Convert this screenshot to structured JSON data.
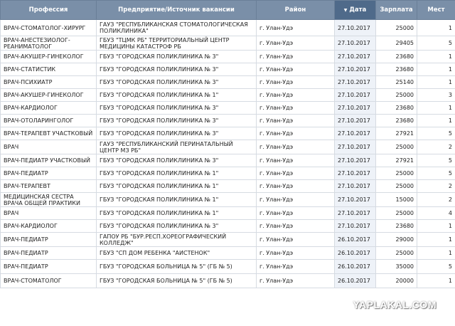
{
  "table": {
    "headers": {
      "profession": "Профессия",
      "employer": "Предприятие/Источник вакансии",
      "district": "Район",
      "date": "Дата",
      "salary": "Зарплата",
      "places": "Мест"
    },
    "sort_icon": "sort-desc-icon",
    "rows": [
      {
        "profession": "Врач-стоматолог-хирург",
        "employer": "ГАУЗ \"Республиканская стоматологическая поликлиника\"",
        "district": "г. Улан-Удэ",
        "date": "27.10.2017",
        "salary": "25000",
        "places": "1"
      },
      {
        "profession": "Врач-анестезиолог-реаниматолог",
        "employer": "ГБУЗ \"ТЦМК РБ\" Территориальный центр медицины катастроф РБ",
        "district": "г. Улан-Удэ",
        "date": "27.10.2017",
        "salary": "29405",
        "places": "5"
      },
      {
        "profession": "Врач-акушер-гинеколог",
        "employer": "ГБУЗ \"Городская поликлиника № 3\"",
        "district": "г. Улан-Удэ",
        "date": "27.10.2017",
        "salary": "23680",
        "places": "1"
      },
      {
        "profession": "Врач-статистик",
        "employer": "ГБУЗ \"Городская поликлиника № 3\"",
        "district": "г. Улан-Удэ",
        "date": "27.10.2017",
        "salary": "23680",
        "places": "1"
      },
      {
        "profession": "Врач-психиатр",
        "employer": "ГБУЗ \"Городская поликлиника № 3\"",
        "district": "г. Улан-Удэ",
        "date": "27.10.2017",
        "salary": "25140",
        "places": "1"
      },
      {
        "profession": "Врач-акушер-гинеколог",
        "employer": "ГБУЗ \"Городская поликлиника № 1\"",
        "district": "г. Улан-Удэ",
        "date": "27.10.2017",
        "salary": "25000",
        "places": "3"
      },
      {
        "profession": "Врач-кардиолог",
        "employer": "ГБУЗ \"Городская поликлиника № 3\"",
        "district": "г. Улан-Удэ",
        "date": "27.10.2017",
        "salary": "23680",
        "places": "1"
      },
      {
        "profession": "Врач-отоларинголог",
        "employer": "ГБУЗ \"Городская поликлиника № 3\"",
        "district": "г. Улан-Удэ",
        "date": "27.10.2017",
        "salary": "23680",
        "places": "1"
      },
      {
        "profession": "Врач-терапевт участковый",
        "employer": "ГБУЗ \"Городская поликлиника № 3\"",
        "district": "г. Улан-Удэ",
        "date": "27.10.2017",
        "salary": "27921",
        "places": "5"
      },
      {
        "profession": "Врач",
        "employer": "ГАУЗ \"Республиканский перинатальный центр МЗ РБ\"",
        "district": "г. Улан-Удэ",
        "date": "27.10.2017",
        "salary": "25000",
        "places": "2"
      },
      {
        "profession": "Врач-педиатр участковый",
        "employer": "ГБУЗ \"Городская поликлиника № 3\"",
        "district": "г. Улан-Удэ",
        "date": "27.10.2017",
        "salary": "27921",
        "places": "5"
      },
      {
        "profession": "Врач-педиатр",
        "employer": "ГБУЗ \"Городская поликлиника № 1\"",
        "district": "г. Улан-Удэ",
        "date": "27.10.2017",
        "salary": "25000",
        "places": "5"
      },
      {
        "profession": "Врач-терапевт",
        "employer": "ГБУЗ \"Городская поликлиника № 1\"",
        "district": "г. Улан-Удэ",
        "date": "27.10.2017",
        "salary": "25000",
        "places": "2"
      },
      {
        "profession": "Медицинская сестра врача общей практики",
        "employer": "ГБУЗ \"Городская поликлиника № 1\"",
        "district": "г. Улан-Удэ",
        "date": "27.10.2017",
        "salary": "15000",
        "places": "2"
      },
      {
        "profession": "Врач",
        "employer": "ГБУЗ \"Городская поликлиника № 1\"",
        "district": "г. Улан-Удэ",
        "date": "27.10.2017",
        "salary": "25000",
        "places": "4"
      },
      {
        "profession": "Врач-кардиолог",
        "employer": "ГБУЗ \"Городская поликлиника № 3\"",
        "district": "г. Улан-Удэ",
        "date": "27.10.2017",
        "salary": "23680",
        "places": "1"
      },
      {
        "profession": "Врач-педиатр",
        "employer": "ГАПОУ РБ \"Бур.респ.хореографический колледж\"",
        "district": "г. Улан-Удэ",
        "date": "26.10.2017",
        "salary": "29000",
        "places": "1"
      },
      {
        "profession": "Врач-педиатр",
        "employer": "ГБУЗ \"СП Дом ребенка \"Аистенок\"",
        "district": "г. Улан-Удэ",
        "date": "26.10.2017",
        "salary": "25000",
        "places": "1"
      },
      {
        "profession": "Врач-педиатр",
        "employer": "ГБУЗ \"Городская больница № 5\" (ГБ № 5)",
        "district": "г. Улан-Удэ",
        "date": "26.10.2017",
        "salary": "35000",
        "places": "5"
      },
      {
        "profession": "Врач-стоматолог",
        "employer": "ГБУЗ \"Городская больница № 5\" (ГБ № 5)",
        "district": "г. Улан-Удэ",
        "date": "26.10.2017",
        "salary": "20000",
        "places": "1"
      }
    ]
  },
  "watermark": "YAPLAKAL.COM"
}
